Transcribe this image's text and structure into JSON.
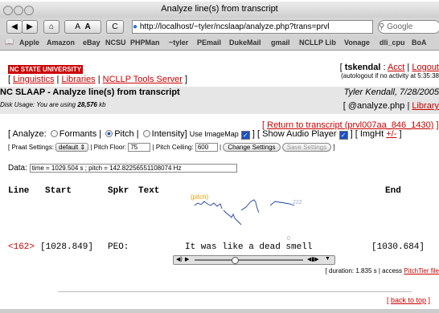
{
  "caption": "example",
  "window": {
    "title": "Analyze line(s) from transcript",
    "url": "http://localhost/~tyler/ncslaap/analyze.php?trans=prvl",
    "search_placeholder": "Google",
    "nav_labels": [
      "◀",
      "▶",
      "⌂",
      "A",
      "A",
      "C"
    ]
  },
  "bookmarks": [
    "Apple",
    "Amazon",
    "eBay",
    "NCSU",
    "PHPMan",
    "~tyler",
    "PEmail",
    "DukeMail",
    "gmail",
    "NCLLP Lib",
    "Vonage",
    "dli_cpu",
    "BoA"
  ],
  "header": {
    "university": "NC STATE UNIVERSITY",
    "nav": [
      "Linguistics",
      "Libraries",
      "NCLLP Tools Server"
    ],
    "user": "tskendal",
    "acct": "Acct",
    "logout": "Logout",
    "autologout": "(autologout if no activity at 5:35:38",
    "title": "NC SLAAP - Analyze line(s) from transcript",
    "author_date": "Tyler Kendall, 7/28/2005",
    "disk_usage_label": "Disk Usage: You are using",
    "disk_usage_value": "28,576",
    "disk_usage_unit": "kb",
    "page_file": "[ @analyze.php |",
    "library": "Library"
  },
  "controls": {
    "return_link": "Return to transcript (prvl007aa_846_1430)",
    "analyze": "[ Analyze:",
    "formants": "Formants",
    "pitch": "Pitch",
    "intensity": "Intensity]",
    "use_imagemap": "Use ImageMap",
    "show_audio": "[ Show Audio Player",
    "imght": "] [ ImgHt",
    "plusminus": "+/-",
    "praat_settings": "[ Praat Settings:",
    "praat_select": "default",
    "pitch_floor": "| Pitch Floor:",
    "pitch_floor_value": "75",
    "pitch_ceiling": "| Pitch Ceiling:",
    "pitch_ceiling_value": "600",
    "change_settings": "Change Settings",
    "save_settings": "Save Settings",
    "data_label": "Data:",
    "data_value": "time = 1029.504 s ; pitch = 142.82256551108074 Hz"
  },
  "table": {
    "headers": [
      "Line",
      "Start",
      "Spkr",
      "Text",
      "End"
    ],
    "line_num": "<162>",
    "start": "[1028.849]",
    "spkr": "PEO:",
    "text": "It was like a dead smell",
    "end": "[1030.684]"
  },
  "pitch_plot": {
    "label": "(pitch)",
    "ymax_label": "222",
    "ymin_label": "0"
  },
  "footer": {
    "duration": "[ duration: 1.835 s | access",
    "pitchtier": "PitchTier file",
    "back_to_top": "back to top"
  }
}
